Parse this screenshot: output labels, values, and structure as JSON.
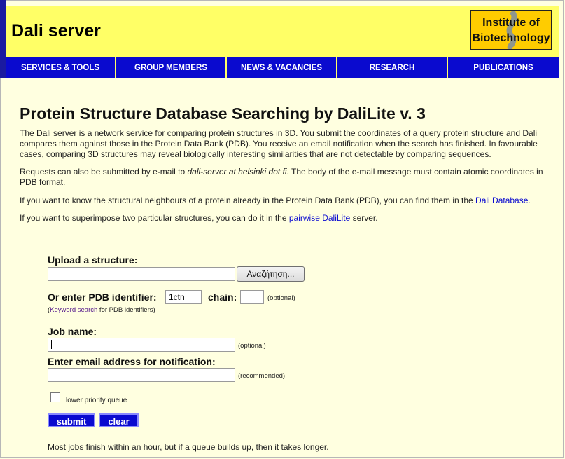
{
  "header": {
    "title": "Dali server",
    "logo_line1": "Institute of",
    "logo_line2": "Biotechnology"
  },
  "nav": [
    {
      "label": "SERVICES & TOOLS"
    },
    {
      "label": "GROUP MEMBERS"
    },
    {
      "label": "NEWS & VACANCIES"
    },
    {
      "label": "RESEARCH"
    },
    {
      "label": "PUBLICATIONS"
    }
  ],
  "main": {
    "heading": "Protein Structure Database Searching by DaliLite v. 3",
    "para1": "The Dali server is a network service for comparing protein structures in 3D. You submit the coordinates of a query protein structure and Dali compares them against those in the Protein Data Bank (PDB). You receive an email notification when the search has finished. In favourable cases, comparing 3D structures may reveal biologically interesting similarities that are not detectable by comparing sequences.",
    "para2_a": "Requests can also be submitted by e-mail to ",
    "para2_email": "dali-server at helsinki dot fi",
    "para2_b": ". The body of the e-mail message must contain atomic coordinates in PDB format.",
    "para3_a": "If you want to know the structural neighbours of a protein already in the Protein Data Bank (PDB), you can find them in the ",
    "para3_link": "Dali Database",
    "para3_b": ".",
    "para4_a": "If you want to superimpose two particular structures, you can do it in the ",
    "para4_link": "pairwise DaliLite",
    "para4_b": " server."
  },
  "form": {
    "upload_label": "Upload a structure:",
    "browse_label": "Αναζήτηση...",
    "pdb_label": "Or enter PDB identifier:",
    "pdb_value": "1ctn",
    "chain_label": "chain:",
    "chain_value": "",
    "optional": "(optional)",
    "keyword_open": "(",
    "keyword_link": "Keyword search",
    "keyword_rest": " for PDB identifiers)",
    "jobname_label": "Job name:",
    "jobname_value": "",
    "email_label": "Enter email address for notification:",
    "email_value": "",
    "recommended": "(recommended)",
    "priority_label": "lower priority queue",
    "submit_label": "submit",
    "clear_label": "clear",
    "footer_note": "Most jobs finish within an hour, but if a queue builds up, then it takes longer."
  }
}
